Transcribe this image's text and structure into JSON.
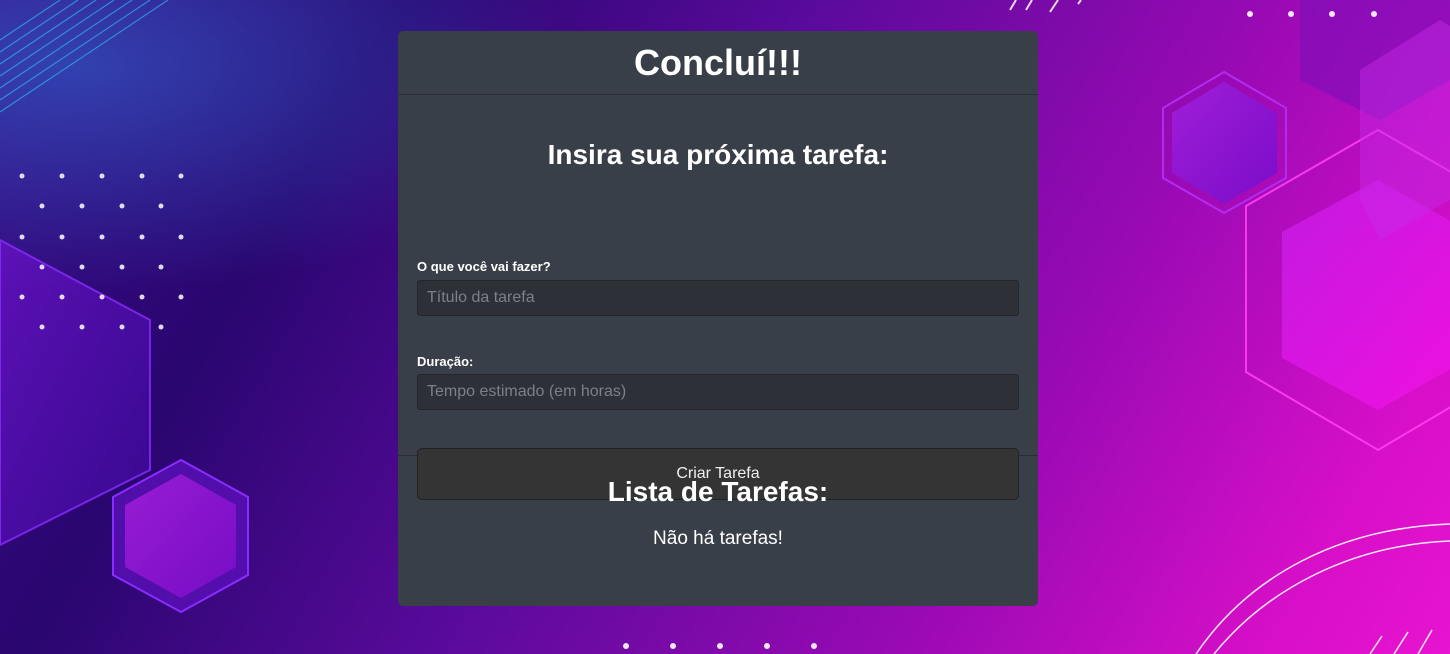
{
  "app": {
    "title": "Concluí!!!"
  },
  "form": {
    "heading": "Insira sua próxima tarefa:",
    "task_label": "O que você vai fazer?",
    "task_placeholder": "Título da tarefa",
    "task_value": "",
    "duration_label": "Duração:",
    "duration_placeholder": "Tempo estimado (em horas)",
    "duration_value": "",
    "submit_label": "Criar Tarefa"
  },
  "task_list": {
    "heading": "Lista de Tarefas:",
    "empty_message": "Não há tarefas!"
  },
  "theme": {
    "card_background": "#383f48",
    "input_background": "#2d3137",
    "button_background": "#343434",
    "background_gradient": [
      "#3a0a86",
      "#2a0670",
      "#9a0ab4",
      "#e714d0"
    ]
  }
}
